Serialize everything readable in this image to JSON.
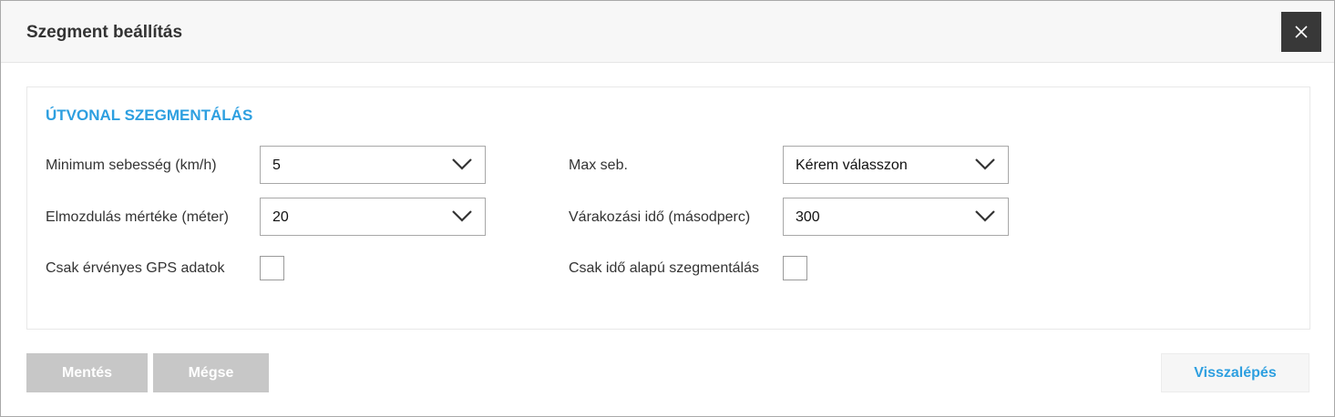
{
  "dialog": {
    "title": "Szegment beállítás",
    "close_icon": "close-icon"
  },
  "section": {
    "title": "ÚTVONAL SZEGMENTÁLÁS"
  },
  "fields": {
    "min_speed": {
      "label": "Minimum sebesség (km/h)",
      "value": "5"
    },
    "displacement": {
      "label": "Elmozdulás mértéke (méter)",
      "value": "20"
    },
    "valid_gps": {
      "label": "Csak érvényes GPS adatok",
      "checked": false
    },
    "max_speed": {
      "label": "Max seb.",
      "value": "Kérem válasszon"
    },
    "wait_time": {
      "label": "Várakozási idő (másodperc)",
      "value": "300"
    },
    "time_based": {
      "label": "Csak idő alapú szegmentálás",
      "checked": false
    }
  },
  "buttons": {
    "save": "Mentés",
    "cancel": "Mégse",
    "back": "Visszalépés"
  },
  "colors": {
    "accent": "#2d9fe0",
    "close_bg": "#383838",
    "disabled_btn": "#c7c7c7"
  }
}
